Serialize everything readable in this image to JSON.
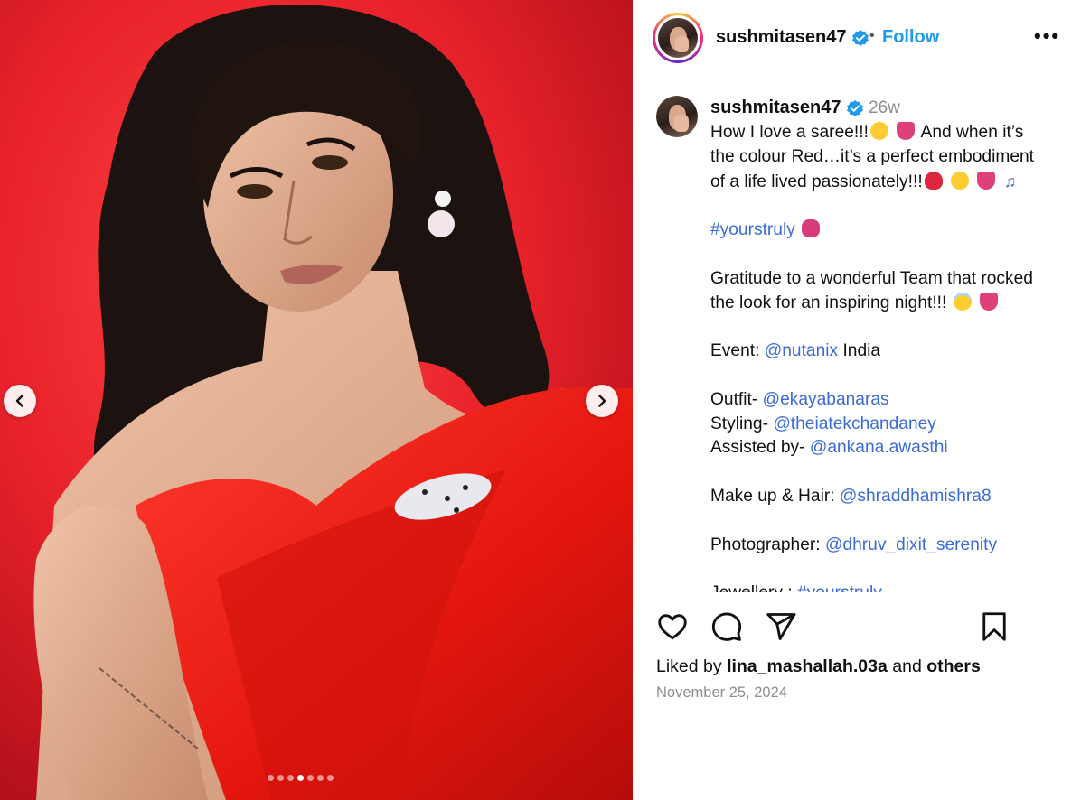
{
  "media": {
    "prev_icon": "chevron-left-icon",
    "next_icon": "chevron-right-icon",
    "slides_total": 7,
    "active_slide": 4
  },
  "header": {
    "username": "sushmitasen47",
    "verified_icon": "verified-badge-icon",
    "bullet": "•",
    "follow_label": "Follow",
    "more_icon": "more-options-icon",
    "more_label": "•••"
  },
  "caption": {
    "username": "sushmitasen47",
    "time_ago": "26w",
    "line1": "How I love a saree!!!",
    "line1b": "And when it’s",
    "line2": "the colour Red…it’s a perfect embodiment",
    "line3": "of a life lived passionately!!!",
    "hashtag1": "#yourstruly",
    "gratitude1": "Gratitude to a wonderful Team that rocked",
    "gratitude2": "the look for an inspiring night!!!",
    "event_label": "Event:",
    "event_handle": "@nutanix",
    "event_suffix": "India",
    "outfit_label": "Outfit-",
    "outfit_handle": "@ekayabanaras",
    "styling_label": "Styling-",
    "styling_handle": "@theiatekchandaney",
    "assisted_label": "Assisted by-",
    "assisted_handle": "@ankana.awasthi",
    "makeup_label": "Make up & Hair:",
    "makeup_handle": "@shraddhamishra8",
    "photo_label": "Photographer:",
    "photo_handle": "@dhruv_dixit_serenity",
    "jewellery_label": "Jewellery :",
    "jewellery_handle": "#yourstruly"
  },
  "actions": {
    "like_icon": "heart-icon",
    "comment_icon": "comment-icon",
    "share_icon": "share-icon",
    "save_icon": "bookmark-icon"
  },
  "likes": {
    "prefix": "Liked by",
    "user": "lina_mashallah.03a",
    "middle": "and",
    "others": "others"
  },
  "date": "November 25, 2024",
  "colors": {
    "accent": "#1e9bf0",
    "link": "#3a6bd6",
    "background_red": "#e8222a"
  }
}
